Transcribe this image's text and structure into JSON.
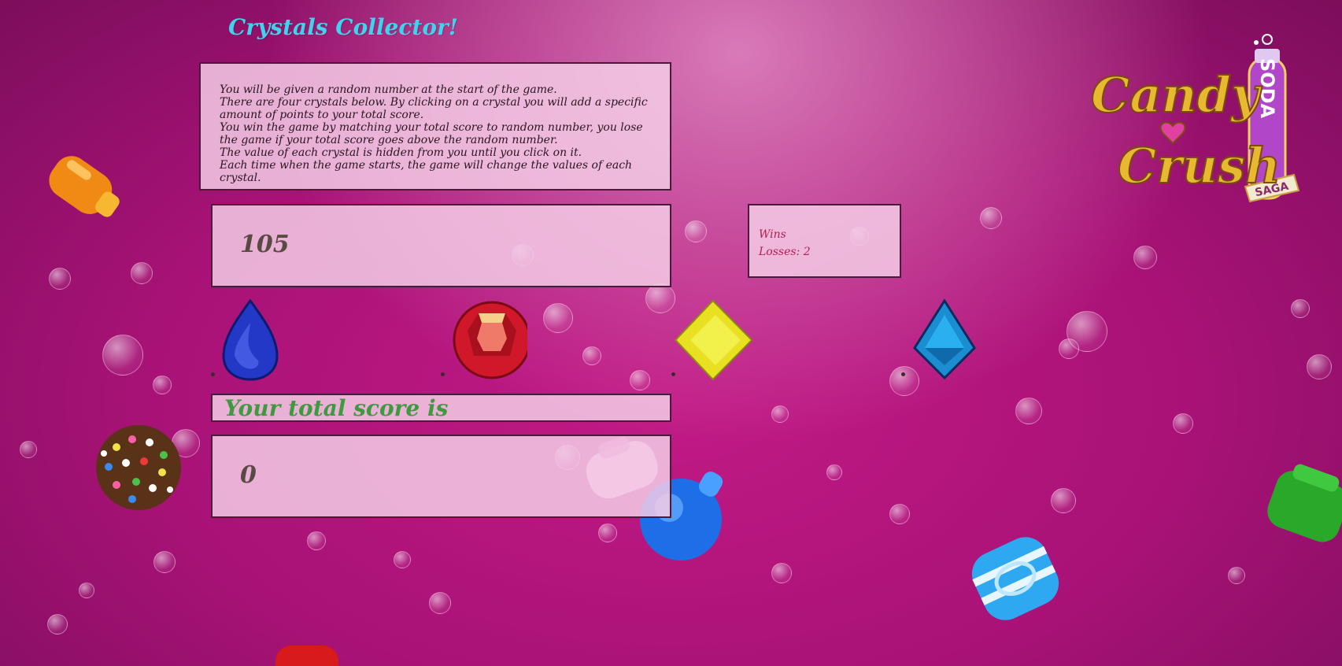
{
  "title": "Crystals Collector!",
  "instructions": [
    "You will be given a random number at the start of the game.",
    "There are four crystals below. By clicking on a crystal you will add a specific amount of points to your total score.",
    "You win the game by matching your total score to random number, you lose the game if your total score goes above the random number.",
    "The value of each crystal is hidden from you until you click on it.",
    "Each time when the game starts, the game will change the values of each crystal."
  ],
  "target_number": "105",
  "record": {
    "wins_label": "Wins",
    "losses_label": "Losses: 2"
  },
  "score_label": "Your total score is",
  "total_score": "0",
  "crystals": [
    {
      "name": "blue-drop-crystal",
      "color": "#2438c8"
    },
    {
      "name": "red-round-crystal",
      "color": "#d0182a"
    },
    {
      "name": "yellow-diamond-crystal",
      "color": "#e8e020"
    },
    {
      "name": "blue-kite-crystal",
      "color": "#1a8ed0"
    }
  ],
  "logo": {
    "line1": "Candy",
    "line2": "Crush",
    "bottle": "SODA",
    "ribbon": "SAGA"
  },
  "colors": {
    "title": "#3fd3ee",
    "score_label": "#3f9a3f",
    "record_text": "#b02050",
    "background": "#b8167e"
  }
}
